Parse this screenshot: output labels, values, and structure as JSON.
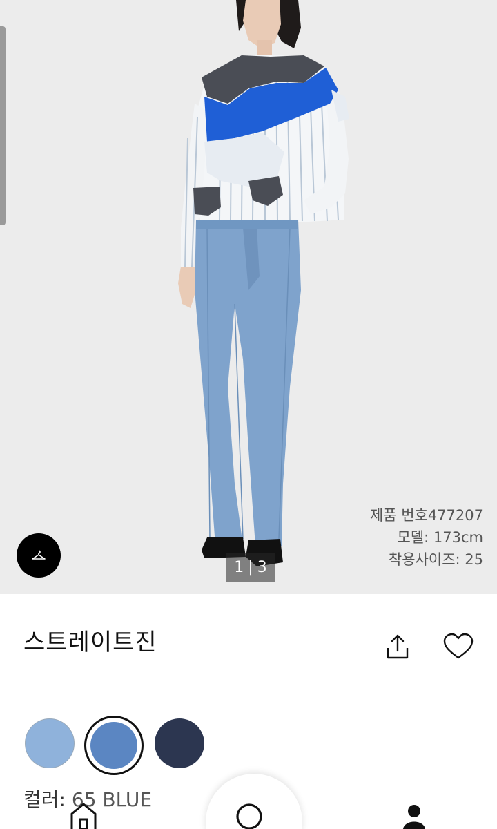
{
  "product": {
    "title": "스트레이트진",
    "meta_code": "제품 번호477207",
    "meta_model": "모델: 173cm",
    "meta_size": "착용사이즈: 25"
  },
  "gallery": {
    "pager_current": "1",
    "pager_total": "3"
  },
  "color": {
    "label": "컬러:",
    "selected_value": "65 BLUE",
    "swatches": [
      {
        "name": "light-blue",
        "hex": "#8fb2db"
      },
      {
        "name": "blue",
        "hex": "#5b86c2"
      },
      {
        "name": "navy",
        "hex": "#2c3650"
      }
    ]
  },
  "icons": {
    "fit": "hanger-icon",
    "share": "share-icon",
    "wishlist": "heart-icon",
    "nav_home": "home-icon",
    "nav_search": "search-icon",
    "nav_account": "account-icon"
  },
  "colors": {
    "hero_bg": "#ececec",
    "denim": "#7fa3cc",
    "royal_blue": "#1f5fd6",
    "charcoal": "#4a4d55"
  }
}
